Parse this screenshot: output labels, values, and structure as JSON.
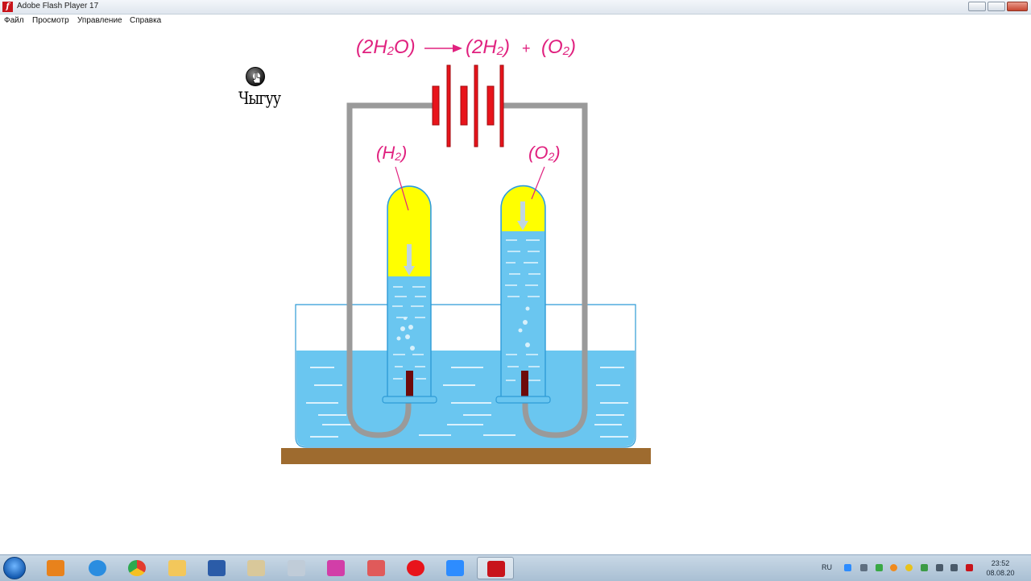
{
  "window": {
    "title": "Adobe Flash Player 17"
  },
  "menu": [
    "Файл",
    "Просмотр",
    "Управление",
    "Справка"
  ],
  "equation": {
    "lhs": "(2H",
    "lhs_sub": "2",
    "lhs_tail": "O)",
    "rhs1": "(2H",
    "rhs1_sub": "2",
    "rhs1_tail": ")",
    "plus": "+",
    "rhs2": "(O",
    "rhs2_sub": "2",
    "rhs2_tail": ")"
  },
  "labels": {
    "h2_label": "(H",
    "h2_sub": "2",
    "h2_tail": ")",
    "o2_label": "(O",
    "o2_sub": "2",
    "o2_tail": ")",
    "start_button": "Чыгуу"
  },
  "colors": {
    "annotation": "#e0217f",
    "battery": "#e8141b",
    "water": "#6ac6f0",
    "gas": "#ffff00",
    "wire": "#9a9a9a",
    "table": "#9e6b2f",
    "electrode": "#6e0a0a"
  },
  "taskbar": {
    "apps": [
      "media-player",
      "internet-explorer",
      "chrome",
      "explorer",
      "word",
      "paint",
      "calculator",
      "gem-app",
      "snipping-tool",
      "yandex",
      "zoom",
      "flash-player"
    ],
    "tray_lang": "RU",
    "time": "23:52",
    "date": "08.08.20"
  }
}
